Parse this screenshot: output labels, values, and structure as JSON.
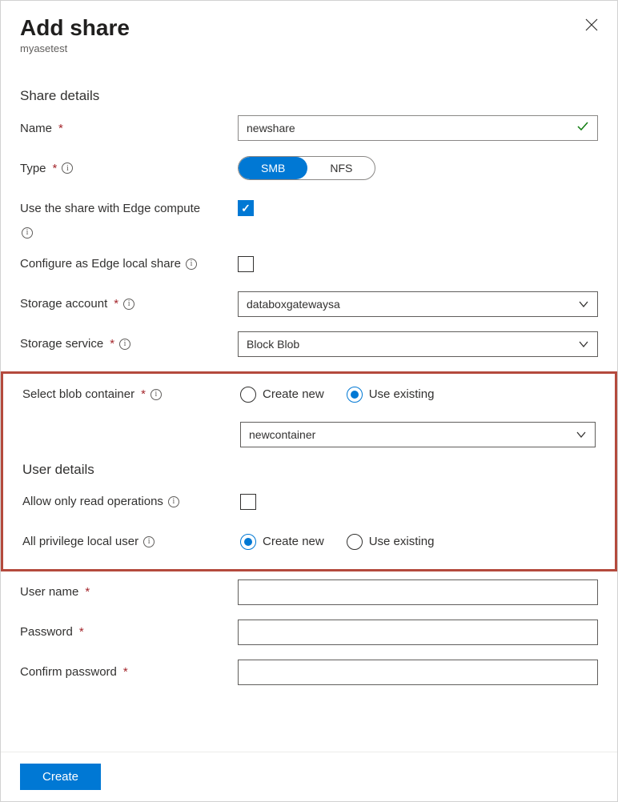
{
  "header": {
    "title": "Add share",
    "subtitle": "myasetest"
  },
  "sections": {
    "share_details": "Share details",
    "user_details": "User details"
  },
  "fields": {
    "name": {
      "label": "Name",
      "value": "newshare"
    },
    "type": {
      "label": "Type",
      "options": {
        "smb": "SMB",
        "nfs": "NFS"
      },
      "selected": "SMB"
    },
    "edge_compute": {
      "label": "Use the share with Edge compute",
      "checked": true
    },
    "edge_local": {
      "label": "Configure as Edge local share",
      "checked": false
    },
    "storage_account": {
      "label": "Storage account",
      "value": "databoxgatewaysa"
    },
    "storage_service": {
      "label": "Storage service",
      "value": "Block Blob"
    },
    "blob_container": {
      "label": "Select blob container",
      "options": {
        "create": "Create new",
        "existing": "Use existing"
      },
      "selected": "Use existing",
      "value": "newcontainer"
    },
    "read_only": {
      "label": "Allow only read operations",
      "checked": false
    },
    "privilege_user": {
      "label": "All privilege local user",
      "options": {
        "create": "Create new",
        "existing": "Use existing"
      },
      "selected": "Create new"
    },
    "username": {
      "label": "User name",
      "value": ""
    },
    "password": {
      "label": "Password",
      "value": ""
    },
    "confirm_password": {
      "label": "Confirm password",
      "value": ""
    }
  },
  "footer": {
    "create_label": "Create"
  }
}
